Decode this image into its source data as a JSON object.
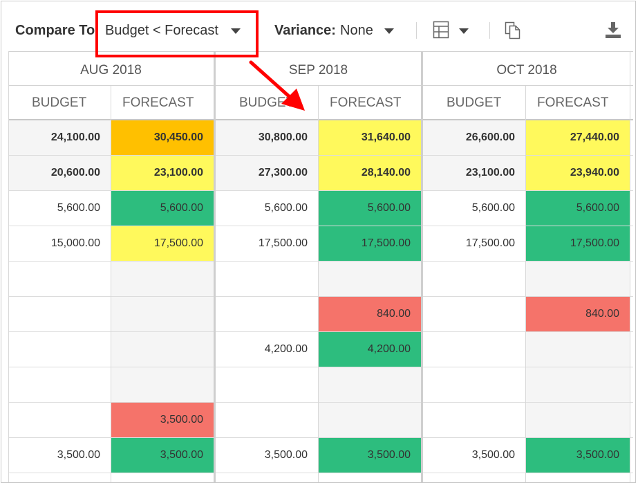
{
  "toolbar": {
    "compare_label": "Compare To:",
    "compare_value": "Budget < Forecast",
    "variance_label": "Variance:",
    "variance_value": "None",
    "icons": [
      "table-layout-icon",
      "chevron-down-icon",
      "copy-icon",
      "download-icon"
    ]
  },
  "months": [
    "AUG 2018",
    "SEP 2018",
    "OCT 2018"
  ],
  "col_headers": [
    "BUDGET",
    "FORECAST",
    "BUDGET",
    "FORECAST",
    "BUDGET",
    "FORECAST"
  ],
  "colors": {
    "green": "#2dbd7e",
    "yellow": "#fff95c",
    "orange": "#ffc000",
    "red": "#f5736a",
    "gray": "#f5f5f5",
    "white": "#ffffff",
    "annotation": "#ff0000"
  },
  "rows": [
    {
      "bold": true,
      "cells": [
        {
          "v": "24,100.00",
          "c": "gray"
        },
        {
          "v": "30,450.00",
          "c": "orange"
        },
        {
          "v": "30,800.00",
          "c": "gray"
        },
        {
          "v": "31,640.00",
          "c": "yellow"
        },
        {
          "v": "26,600.00",
          "c": "gray"
        },
        {
          "v": "27,440.00",
          "c": "yellow"
        }
      ]
    },
    {
      "bold": true,
      "cells": [
        {
          "v": "20,600.00",
          "c": "gray"
        },
        {
          "v": "23,100.00",
          "c": "yellow"
        },
        {
          "v": "27,300.00",
          "c": "gray"
        },
        {
          "v": "28,140.00",
          "c": "yellow"
        },
        {
          "v": "23,100.00",
          "c": "gray"
        },
        {
          "v": "23,940.00",
          "c": "yellow"
        }
      ]
    },
    {
      "bold": false,
      "cells": [
        {
          "v": "5,600.00",
          "c": "white"
        },
        {
          "v": "5,600.00",
          "c": "green"
        },
        {
          "v": "5,600.00",
          "c": "white"
        },
        {
          "v": "5,600.00",
          "c": "green"
        },
        {
          "v": "5,600.00",
          "c": "white"
        },
        {
          "v": "5,600.00",
          "c": "green"
        }
      ]
    },
    {
      "bold": false,
      "cells": [
        {
          "v": "15,000.00",
          "c": "white"
        },
        {
          "v": "17,500.00",
          "c": "yellow"
        },
        {
          "v": "17,500.00",
          "c": "white"
        },
        {
          "v": "17,500.00",
          "c": "green"
        },
        {
          "v": "17,500.00",
          "c": "white"
        },
        {
          "v": "17,500.00",
          "c": "green"
        }
      ]
    },
    {
      "bold": false,
      "cells": [
        {
          "v": "",
          "c": "white"
        },
        {
          "v": "",
          "c": "gray"
        },
        {
          "v": "",
          "c": "white"
        },
        {
          "v": "",
          "c": "gray"
        },
        {
          "v": "",
          "c": "white"
        },
        {
          "v": "",
          "c": "gray"
        }
      ]
    },
    {
      "bold": false,
      "cells": [
        {
          "v": "",
          "c": "white"
        },
        {
          "v": "",
          "c": "gray"
        },
        {
          "v": "",
          "c": "white"
        },
        {
          "v": "840.00",
          "c": "red"
        },
        {
          "v": "",
          "c": "white"
        },
        {
          "v": "840.00",
          "c": "red"
        }
      ]
    },
    {
      "bold": false,
      "cells": [
        {
          "v": "",
          "c": "white"
        },
        {
          "v": "",
          "c": "gray"
        },
        {
          "v": "4,200.00",
          "c": "white"
        },
        {
          "v": "4,200.00",
          "c": "green"
        },
        {
          "v": "",
          "c": "white"
        },
        {
          "v": "",
          "c": "gray"
        }
      ]
    },
    {
      "bold": false,
      "cells": [
        {
          "v": "",
          "c": "white"
        },
        {
          "v": "",
          "c": "gray"
        },
        {
          "v": "",
          "c": "white"
        },
        {
          "v": "",
          "c": "gray"
        },
        {
          "v": "",
          "c": "white"
        },
        {
          "v": "",
          "c": "gray"
        }
      ]
    },
    {
      "bold": false,
      "cells": [
        {
          "v": "",
          "c": "white"
        },
        {
          "v": "3,500.00",
          "c": "red"
        },
        {
          "v": "",
          "c": "white"
        },
        {
          "v": "",
          "c": "gray"
        },
        {
          "v": "",
          "c": "white"
        },
        {
          "v": "",
          "c": "gray"
        }
      ]
    },
    {
      "bold": false,
      "cells": [
        {
          "v": "3,500.00",
          "c": "white"
        },
        {
          "v": "3,500.00",
          "c": "green"
        },
        {
          "v": "3,500.00",
          "c": "white"
        },
        {
          "v": "3,500.00",
          "c": "green"
        },
        {
          "v": "3,500.00",
          "c": "white"
        },
        {
          "v": "3,500.00",
          "c": "green"
        }
      ]
    }
  ]
}
